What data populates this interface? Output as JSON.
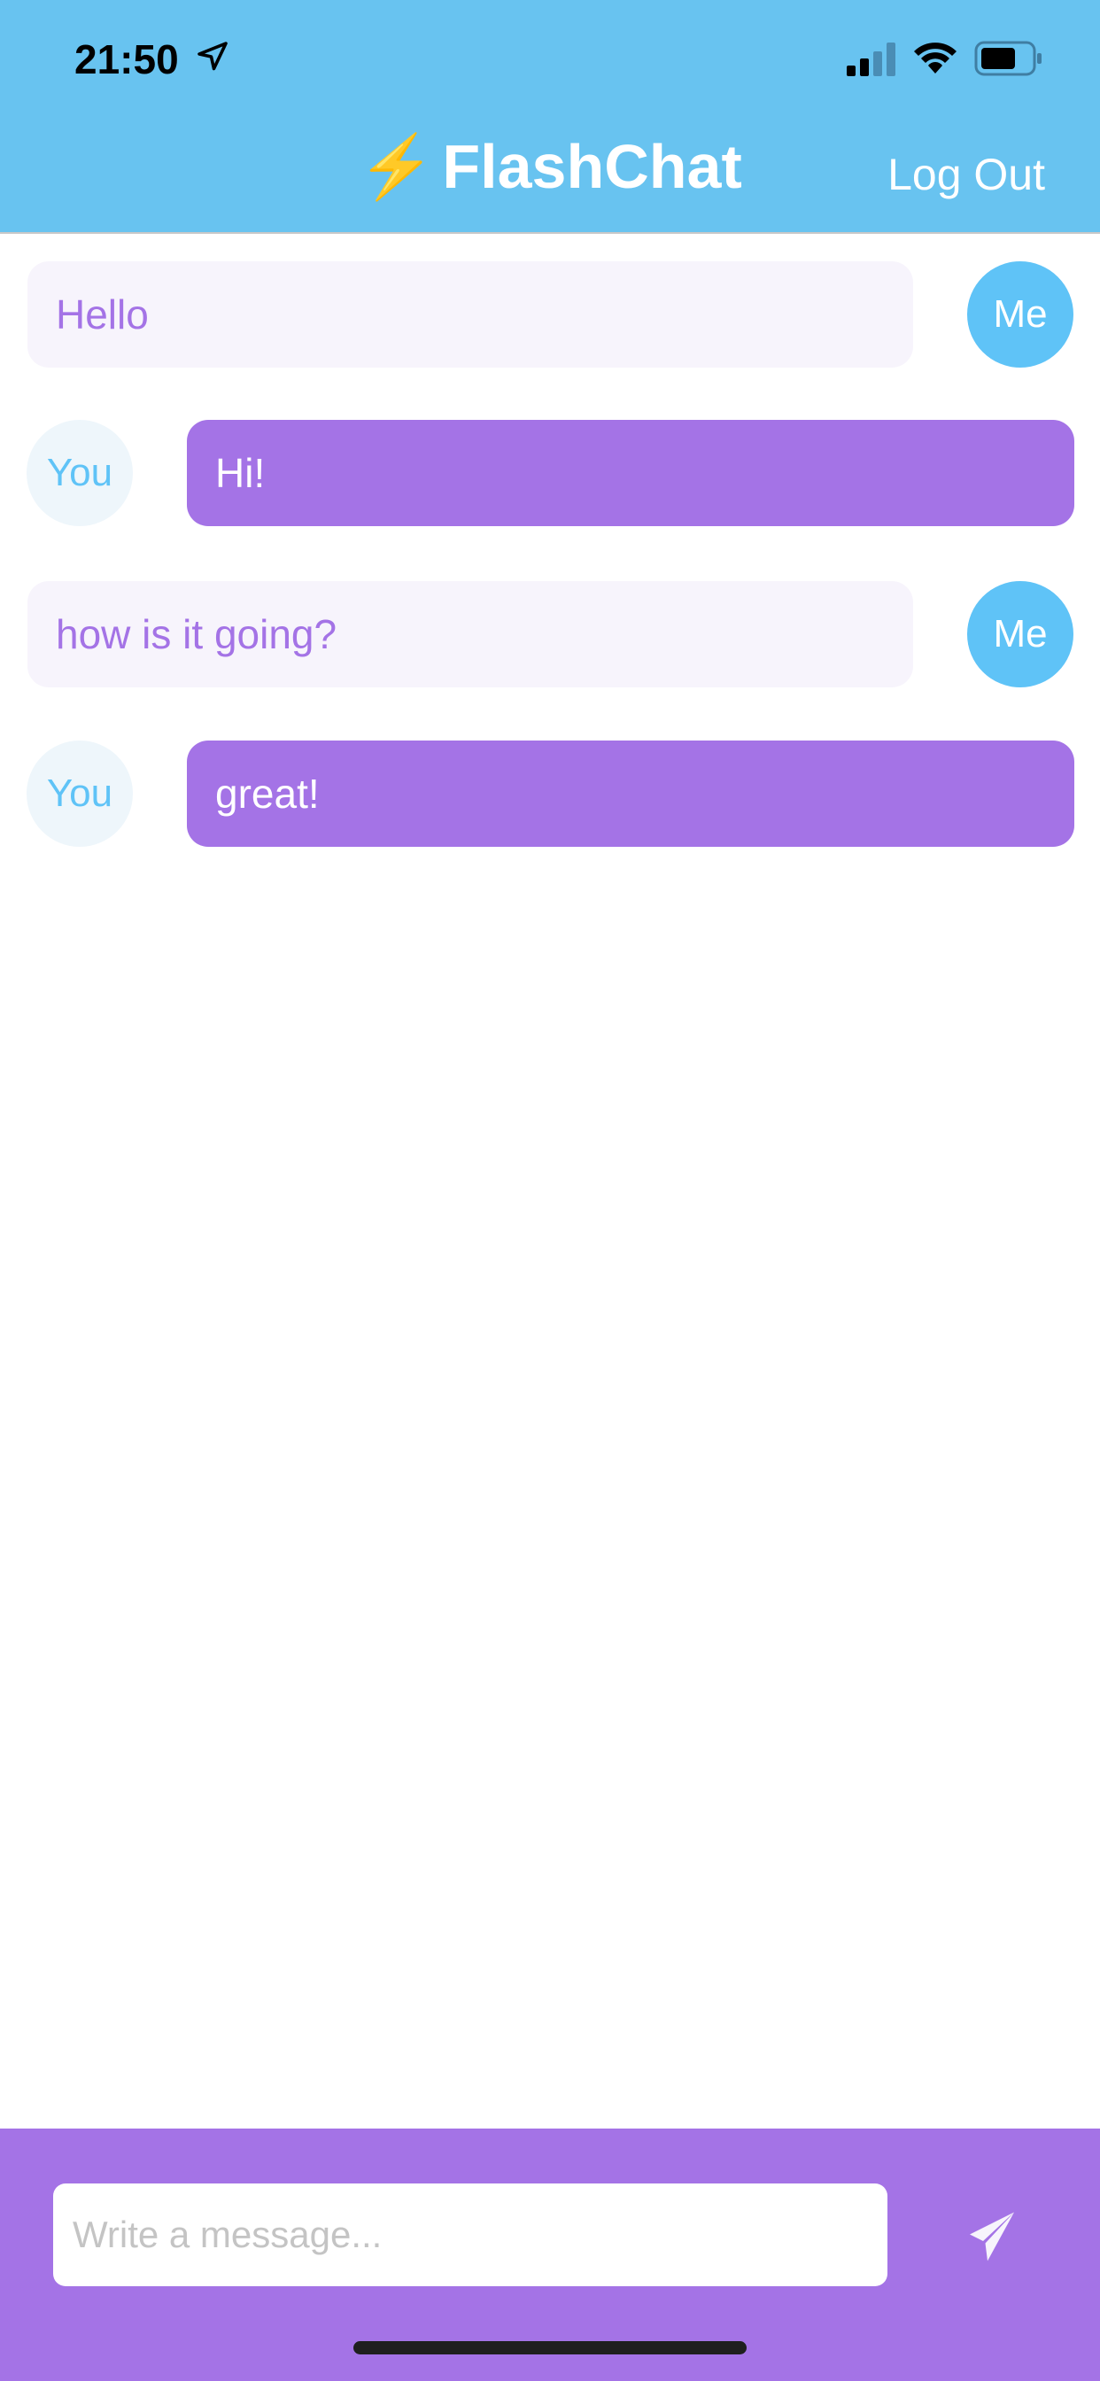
{
  "status_bar": {
    "time": "21:50"
  },
  "header": {
    "title": "FlashChat",
    "logout_label": "Log Out"
  },
  "messages": [
    {
      "sender": "Me",
      "text": "Hello"
    },
    {
      "sender": "You",
      "text": "Hi!"
    },
    {
      "sender": "Me",
      "text": "how is it going?"
    },
    {
      "sender": "You",
      "text": "great!"
    }
  ],
  "composer": {
    "placeholder": "Write a message...",
    "value": ""
  },
  "colors": {
    "header": "#68C3F0",
    "accent": "#A473E6",
    "avatar_me": "#5FC3F7"
  }
}
